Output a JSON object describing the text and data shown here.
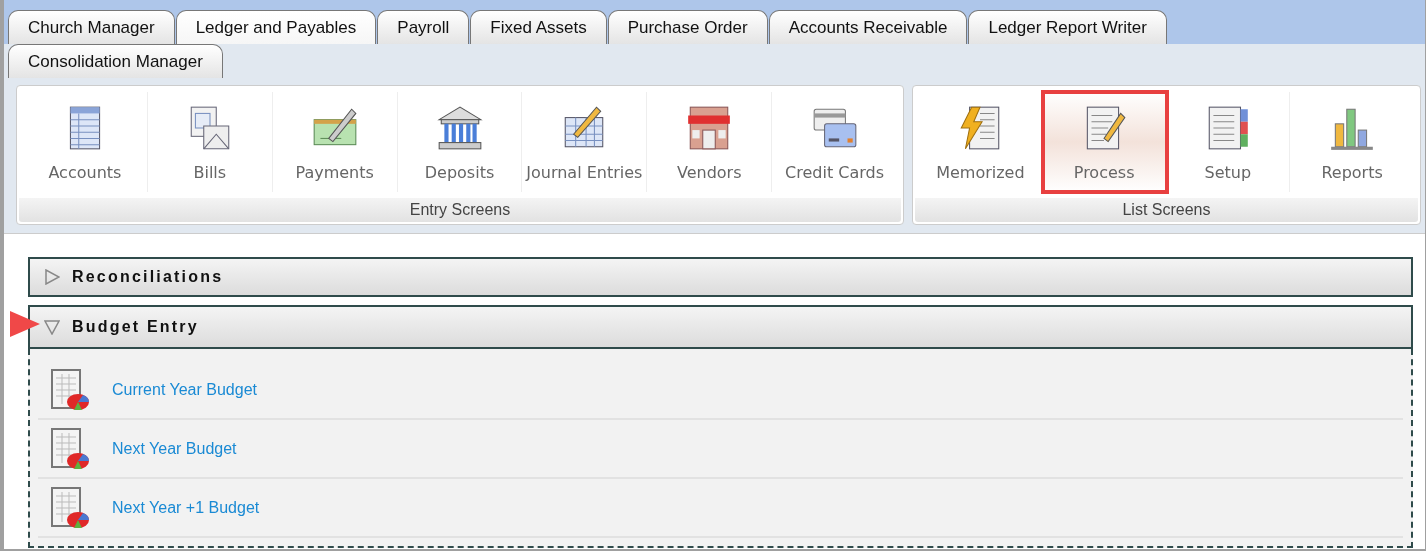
{
  "tab_rows": [
    [
      {
        "label": "Church Manager",
        "selected": false
      },
      {
        "label": "Ledger and Payables",
        "selected": true
      },
      {
        "label": "Payroll",
        "selected": false
      },
      {
        "label": "Fixed Assets",
        "selected": false
      },
      {
        "label": "Purchase Order",
        "selected": false
      },
      {
        "label": "Accounts Receivable",
        "selected": false
      },
      {
        "label": "Ledger Report Writer",
        "selected": false
      }
    ],
    [
      {
        "label": "Consolidation Manager",
        "selected": false
      }
    ]
  ],
  "toolbar_groups": [
    {
      "label": "Entry Screens",
      "items": [
        {
          "label": "Accounts",
          "highlighted": false
        },
        {
          "label": "Bills",
          "highlighted": false
        },
        {
          "label": "Payments",
          "highlighted": false
        },
        {
          "label": "Deposits",
          "highlighted": false
        },
        {
          "label": "Journal Entries",
          "highlighted": false
        },
        {
          "label": "Vendors",
          "highlighted": false
        },
        {
          "label": "Credit Cards",
          "highlighted": false
        }
      ]
    },
    {
      "label": "List Screens",
      "items": [
        {
          "label": "Memorized",
          "highlighted": false
        },
        {
          "label": "Process",
          "highlighted": true
        },
        {
          "label": "Setup",
          "highlighted": false
        },
        {
          "label": "Reports",
          "highlighted": false
        }
      ]
    }
  ],
  "sections": [
    {
      "title": "Reconciliations",
      "expanded": false,
      "pointer": false
    },
    {
      "title": "Budget Entry",
      "expanded": true,
      "pointer": true,
      "links": [
        "Current Year Budget",
        "Next Year Budget",
        "Next Year +1 Budget"
      ]
    }
  ]
}
